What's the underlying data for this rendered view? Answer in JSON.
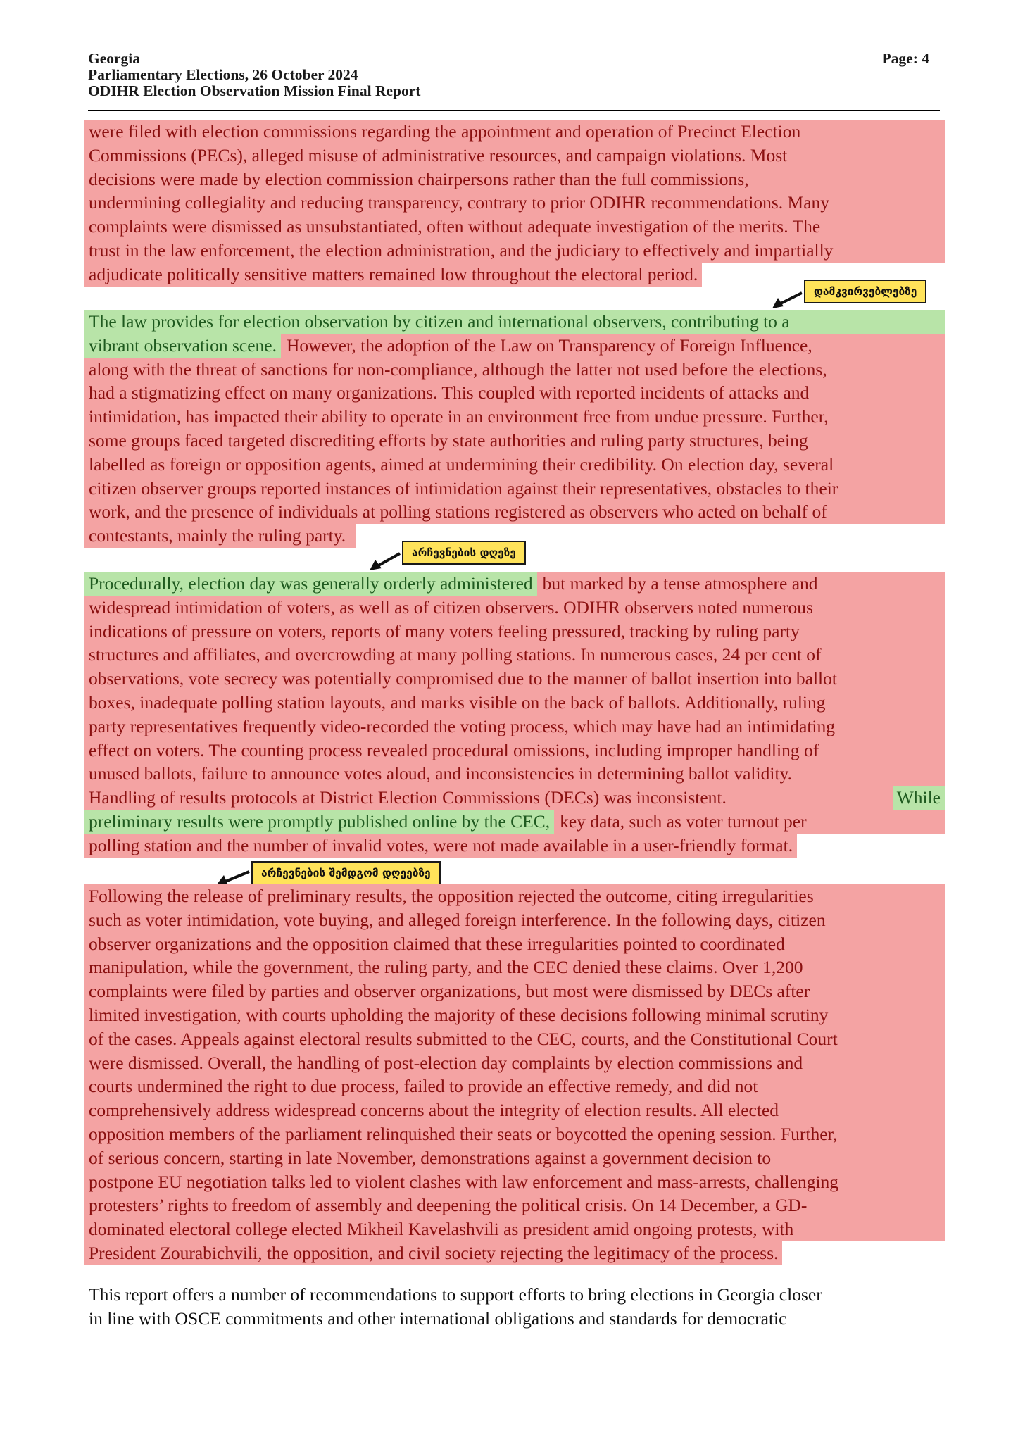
{
  "header": {
    "line1": "Georgia",
    "line2": "Parliamentary Elections, 26 October 2024",
    "line3": "ODIHR Election Observation Mission Final Report",
    "page": "Page: 4"
  },
  "colors": {
    "negative": "#f4a3a3",
    "positive": "#b8e4a8",
    "label": "#ffe35a"
  },
  "labels": {
    "observers": "დამკვირვებლებზე",
    "election_day": "არჩევნების დღეზე",
    "post_election": "არჩევნების შემდგომ დღეებზე"
  },
  "p1": {
    "lines": [
      "were filed with election commissions regarding the appointment and operation of Precinct Election",
      "Commissions (PECs), alleged misuse of administrative resources, and campaign violations. Most",
      "decisions were made by election commission chairpersons rather than the full commissions,",
      "undermining collegiality and reducing transparency, contrary to prior ODIHR recommendations. Many",
      "complaints were dismissed as unsubstantiated, often without adequate investigation of the merits. The",
      "trust in the law enforcement, the election administration, and the judiciary to effectively and impartially",
      "adjudicate politically sensitive matters remained low throughout the electoral period."
    ]
  },
  "p2": {
    "line1_green": "The law provides for election observation by citizen and international observers, contributing to a",
    "line2_green": "vibrant observation scene.",
    "line2_red": "However, the adoption of the Law on Transparency of Foreign Influence,",
    "lines_red": [
      "along with the threat of sanctions for non-compliance, although the latter not used before the elections,",
      "had a stigmatizing effect on many organizations. This coupled with reported incidents of attacks and",
      "intimidation, has impacted their ability to operate in an environment free from undue pressure. Further,",
      "some groups faced targeted discrediting efforts by state authorities and ruling party structures, being",
      "labelled as foreign or opposition agents, aimed at undermining their credibility. On election day, several",
      "citizen observer groups reported instances of intimidation against their representatives, obstacles to their",
      "work, and the presence of individuals at polling stations registered as observers who acted on behalf of",
      "contestants, mainly the ruling party."
    ]
  },
  "p3": {
    "line1_green": "Procedurally, election day was generally orderly administered",
    "line1_red": "but marked by a tense atmosphere and",
    "lines_red": [
      "widespread intimidation of voters, as well as of citizen observers. ODIHR observers noted numerous",
      "indications of pressure on voters, reports of many voters feeling pressured, tracking by ruling party",
      "structures and affiliates, and overcrowding at many polling stations. In numerous cases, 24 per cent of",
      "observations, vote secrecy was potentially compromised due to the manner of ballot insertion into ballot",
      "boxes, inadequate polling station layouts, and marks visible on the back of ballots. Additionally, ruling",
      "party representatives frequently video-recorded the voting process, which may have had an intimidating",
      "effect on voters. The counting process revealed procedural omissions, including improper handling of",
      "unused ballots, failure to announce votes aloud, and inconsistencies in determining ballot validity."
    ],
    "line10_red": "Handling of results protocols at District Election Commissions (DECs) was inconsistent.",
    "line10_green": "While",
    "line11_green": "preliminary results were promptly published online by the CEC,",
    "line11_red": "key data, such as voter turnout per",
    "line12_red": "polling station and the number of invalid votes, were not made available in a user-friendly format."
  },
  "p4": {
    "lines": [
      "Following the release of preliminary results, the opposition rejected the outcome, citing irregularities",
      "such as voter intimidation, vote buying, and alleged foreign interference. In the following days, citizen",
      "observer organizations and the opposition claimed that these irregularities pointed to coordinated",
      "manipulation, while the government, the ruling party, and the CEC denied these claims. Over 1,200",
      "complaints were filed by parties and observer organizations, but most were dismissed by DECs after",
      "limited investigation, with courts upholding the majority of these decisions following minimal scrutiny",
      "of the cases. Appeals against electoral results submitted to the CEC, courts, and the Constitutional Court",
      "were dismissed. Overall, the handling of post-election day complaints by election commissions and",
      "courts undermined the right to due process, failed to provide an effective remedy, and did not",
      "comprehensively address widespread concerns about the integrity of election results. All elected",
      "opposition members of the parliament relinquished their seats or boycotted the opening session. Further,",
      "of serious concern, starting in late November, demonstrations against a government decision to",
      "postpone EU negotiation talks led to violent clashes with law enforcement and mass-arrests, challenging",
      "protesters’ rights to freedom of assembly and deepening the political crisis. On 14 December, a GD-",
      "dominated electoral college elected Mikheil Kavelashvili as president amid ongoing protests, with",
      "President Zourabichvili, the opposition, and civil society rejecting the legitimacy of the process."
    ]
  },
  "p5": {
    "lines": [
      "This report offers a number of recommendations to support efforts to bring elections in Georgia closer",
      "in line with OSCE commitments and other international obligations and standards for democratic"
    ]
  }
}
